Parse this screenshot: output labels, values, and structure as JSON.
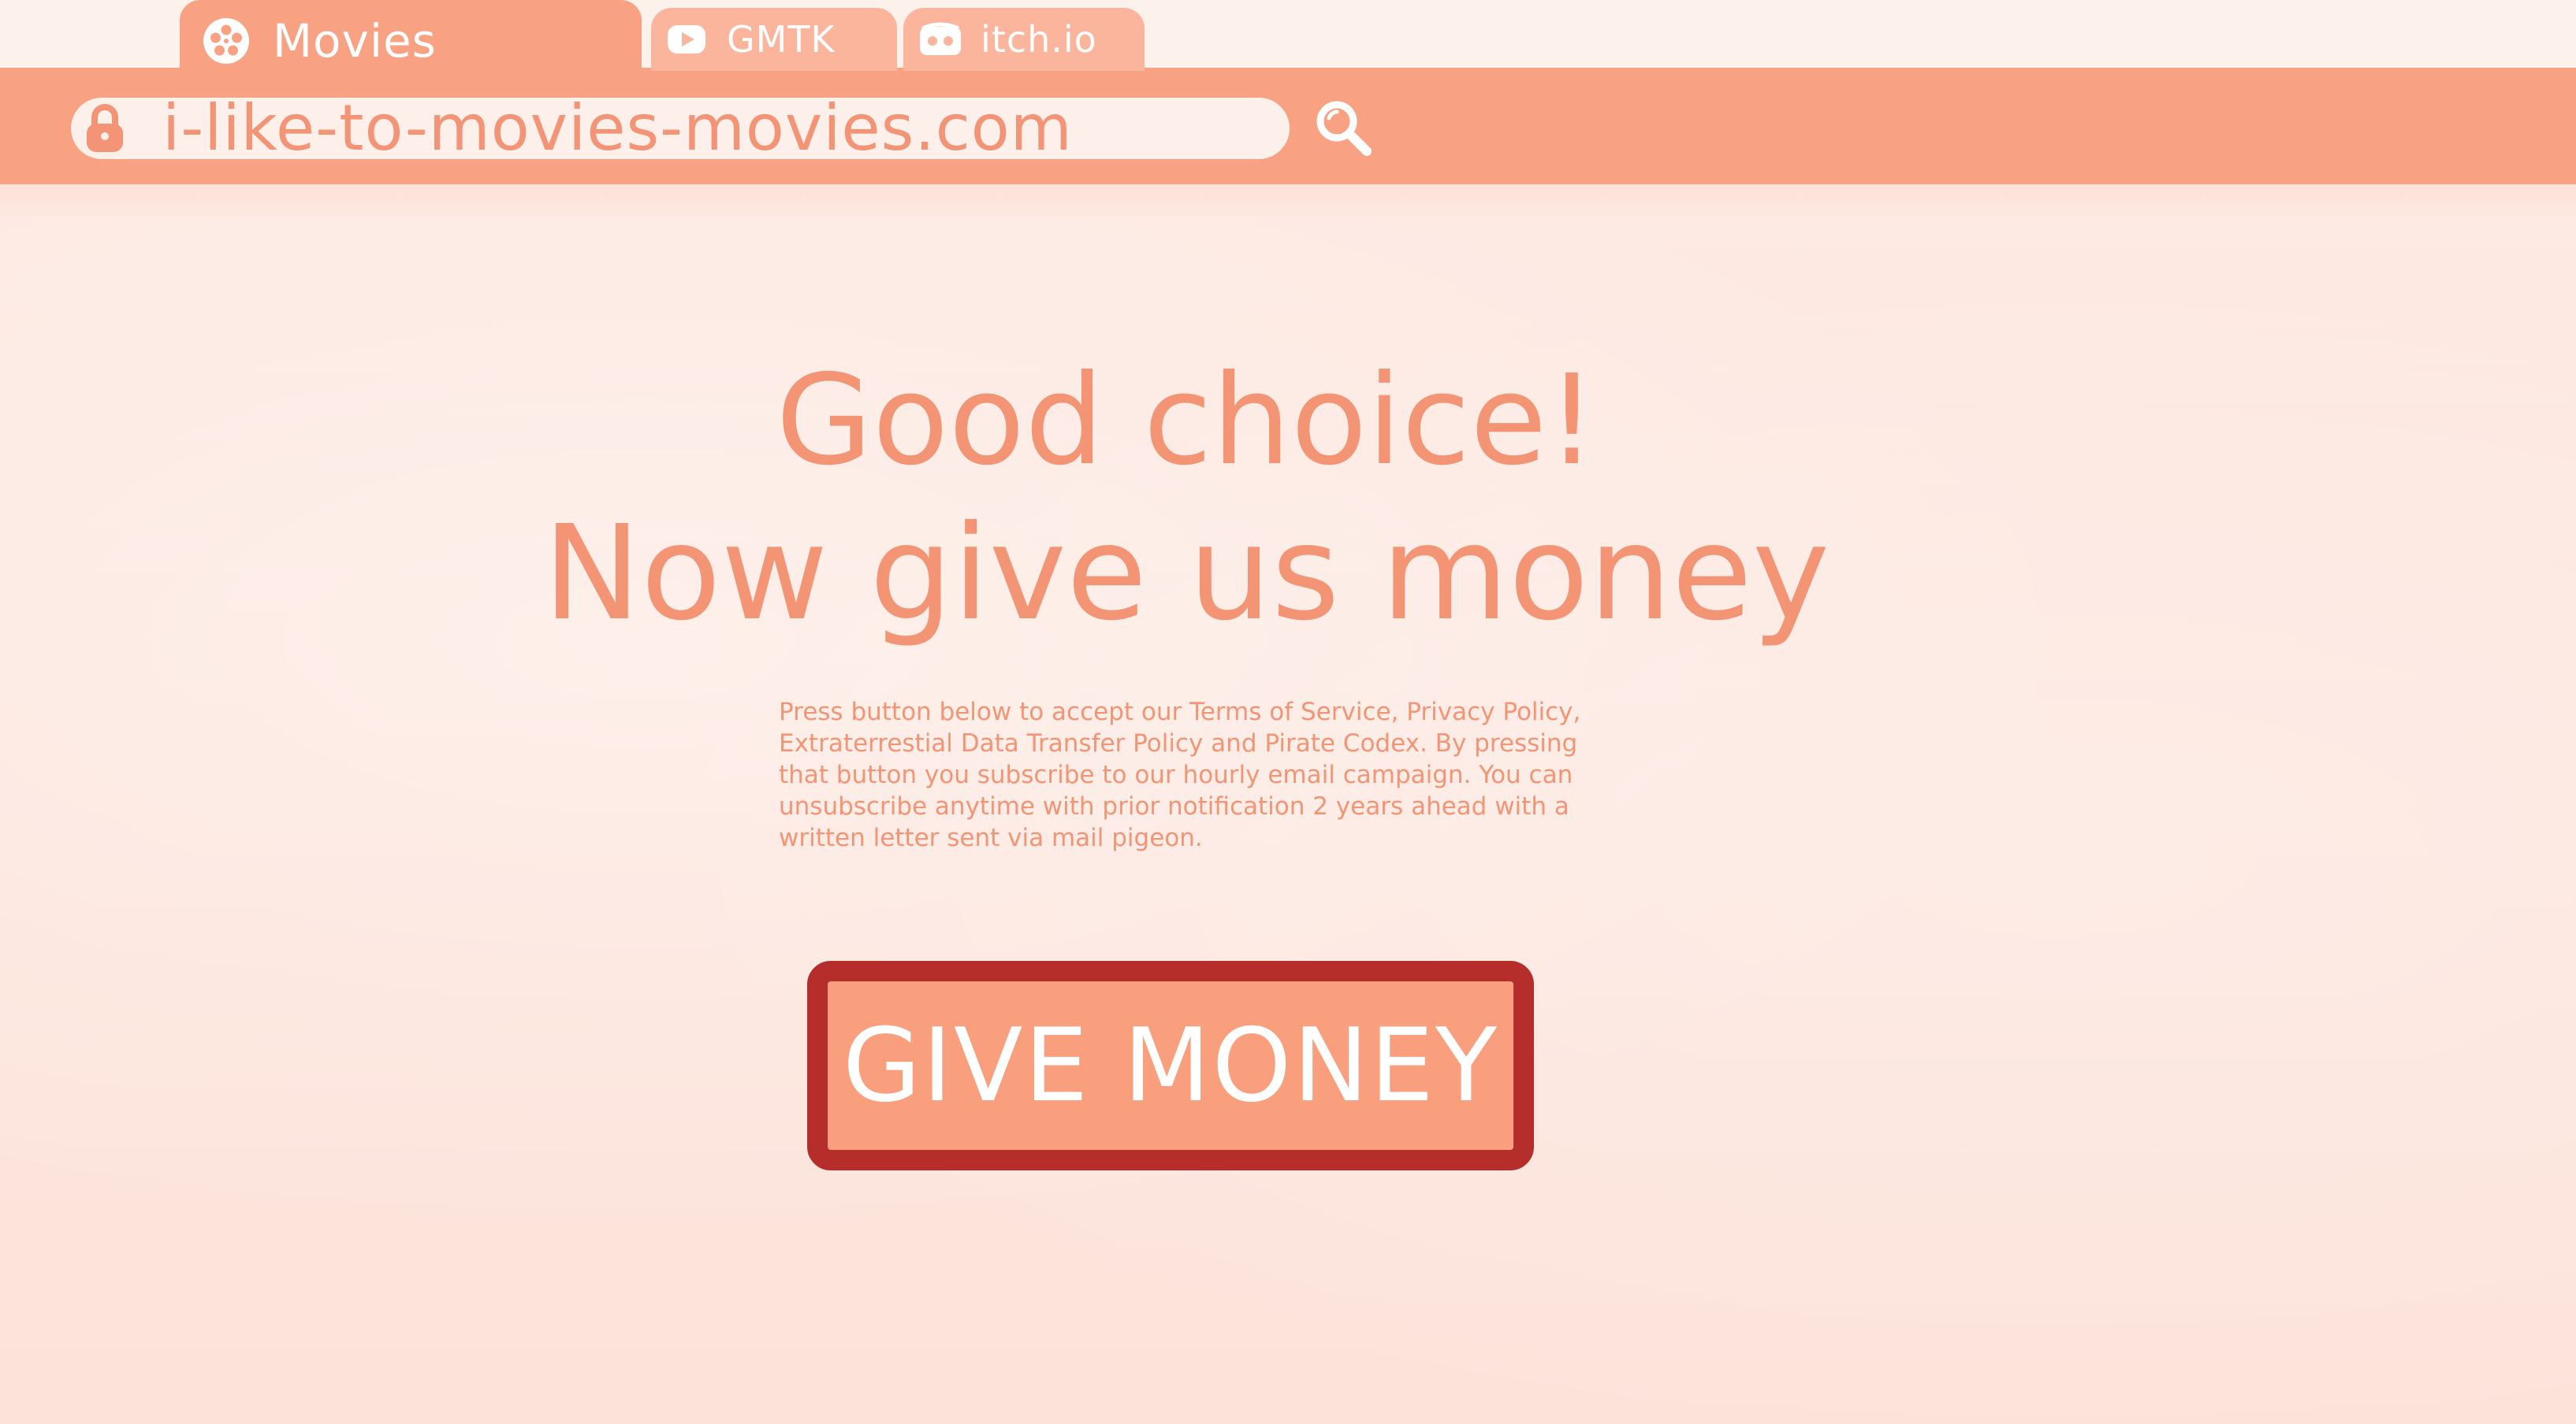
{
  "browser": {
    "tabs": [
      {
        "label": "Movies",
        "icon": "movie-reel-icon",
        "active": true
      },
      {
        "label": "GMTK",
        "icon": "youtube-icon",
        "active": false
      },
      {
        "label": "itch.io",
        "icon": "itch-io-icon",
        "active": false
      }
    ],
    "address_bar": {
      "url": "i-like-to-movies-movies.com",
      "lock_icon": "lock-icon",
      "search_icon": "search-icon"
    }
  },
  "main": {
    "headline_line1": "Good choice!",
    "headline_line2": "Now give us money",
    "terms_text": "Press button below to accept our Terms of Service, Privacy Policy, Extraterrestial Data Transfer Policy and Pirate Codex. By pressing that button you subscribe to our hourly email campaign. You can unsubscribe anytime with prior notification 2 years ahead with a written letter sent via mail pigeon.",
    "give_money_button": "GIVE MONEY"
  },
  "colors": {
    "accent": "#f9a283",
    "text": "#f39574",
    "button_border": "#b52e2c",
    "background": "#fde7df"
  }
}
